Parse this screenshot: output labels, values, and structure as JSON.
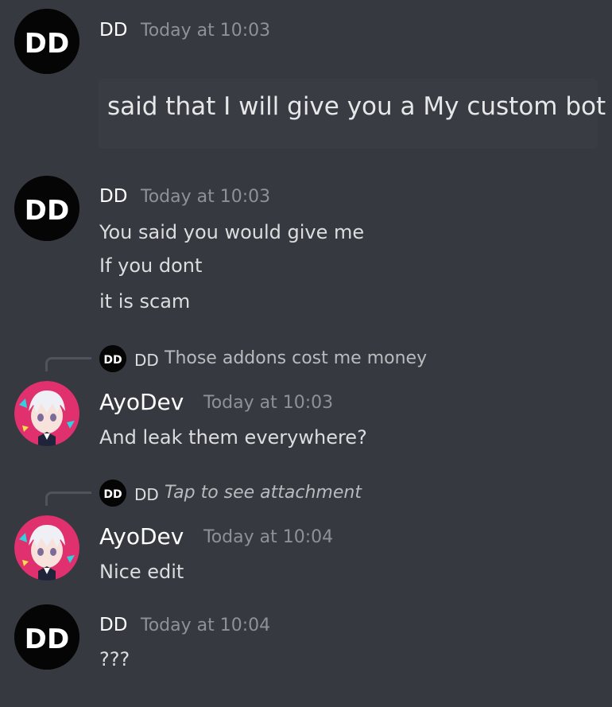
{
  "messages": [
    {
      "author": "DD",
      "timestamp": "Today at 10:03",
      "avatar_icon": "dd-logo-icon",
      "attachment_text": "said that I will give you a My custom bot"
    },
    {
      "author": "DD",
      "timestamp": "Today at 10:03",
      "avatar_icon": "dd-logo-icon",
      "lines": [
        "You said you would give me",
        "If you dont",
        "it is scam"
      ]
    },
    {
      "reply": {
        "author": "DD",
        "text": "Those addons cost me money"
      },
      "author": "AyoDev",
      "timestamp": "Today at 10:03",
      "avatar_icon": "anime-avatar-icon",
      "lines": [
        "And leak them everywhere?"
      ]
    },
    {
      "reply": {
        "author": "DD",
        "text": "Tap to see attachment"
      },
      "author": "AyoDev",
      "timestamp": "Today at 10:04",
      "avatar_icon": "anime-avatar-icon",
      "lines": [
        "Nice edit"
      ]
    },
    {
      "author": "DD",
      "timestamp": "Today at 10:04",
      "avatar_icon": "dd-logo-icon",
      "lines": [
        "???"
      ]
    }
  ],
  "colors": {
    "background": "#36393f",
    "username": "#ffffff",
    "timestamp": "#8e9297",
    "message_text": "#dcddde",
    "dd_avatar_bg": "#050505",
    "ayodev_avatar_bg": "#e0306e"
  }
}
